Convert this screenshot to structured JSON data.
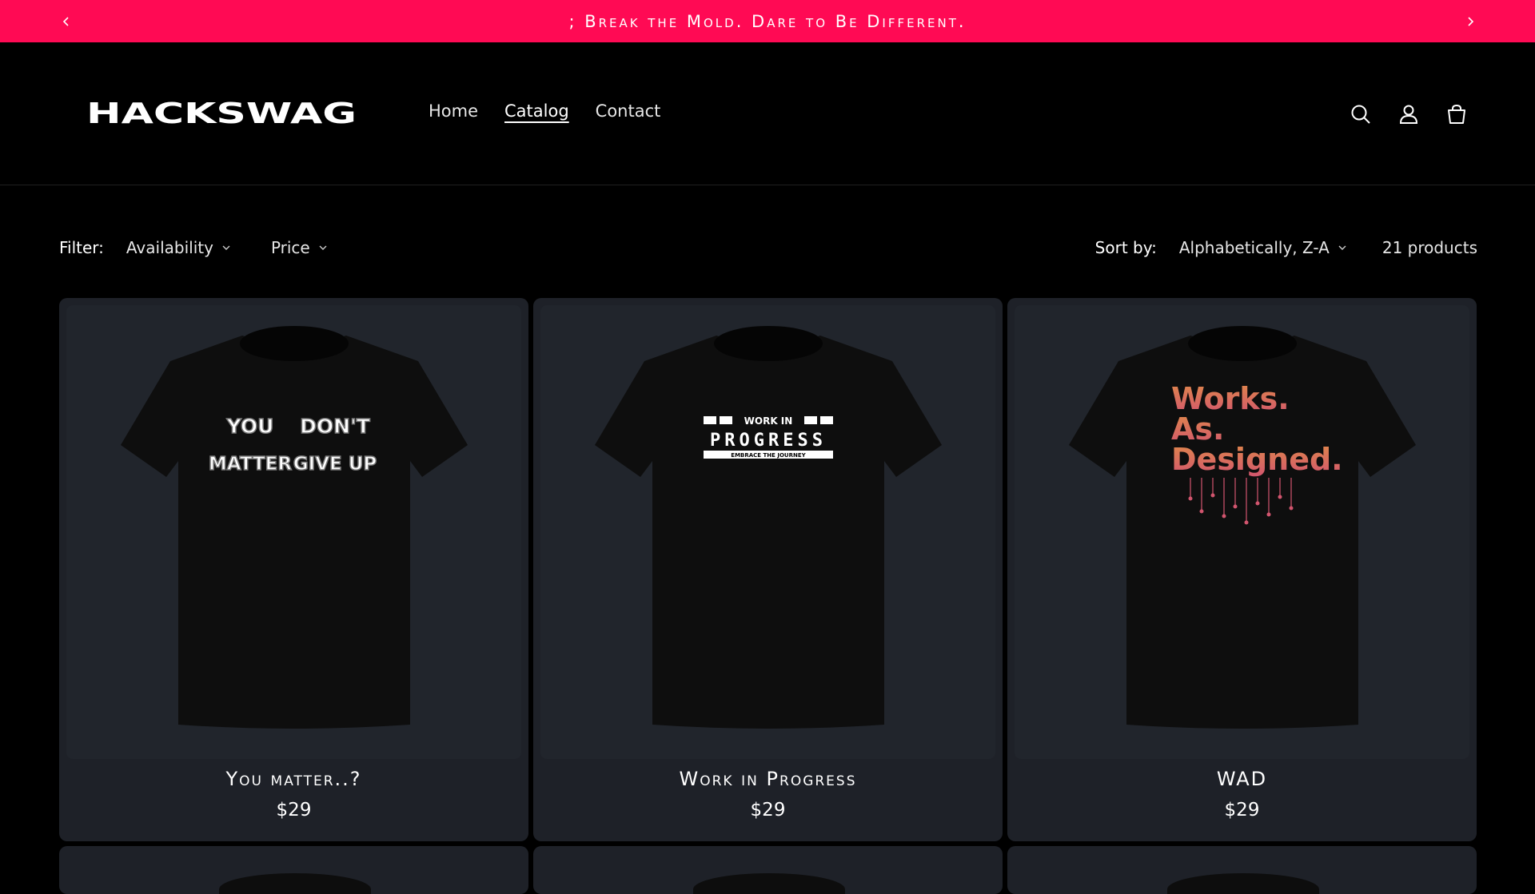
{
  "announcement": {
    "text": "; Break the Mold. Dare to Be Different.",
    "prev_icon": "chevron-left-icon",
    "next_icon": "chevron-right-icon"
  },
  "header": {
    "logo_text": "HACKSWAG",
    "nav": [
      {
        "label": "Home",
        "active": false
      },
      {
        "label": "Catalog",
        "active": true
      },
      {
        "label": "Contact",
        "active": false
      }
    ],
    "icons": [
      "search-icon",
      "account-icon",
      "cart-icon"
    ]
  },
  "facets": {
    "filter_label": "Filter:",
    "filters": [
      "Availability",
      "Price"
    ],
    "sort_label": "Sort by:",
    "sort_value": "Alphabetically, Z-A",
    "count": "21 products"
  },
  "products": [
    {
      "title": "You matter..?",
      "price": "$29",
      "design_text": [
        "YOU",
        "DON'T",
        "MATTER",
        "GIVE UP"
      ]
    },
    {
      "title": "Work in Progress",
      "price": "$29",
      "design_text": [
        "WORK IN",
        "PROGRESS",
        "EMBRACE THE JOURNEY"
      ]
    },
    {
      "title": "WAD",
      "price": "$29",
      "design_text": [
        "Works.",
        "As.",
        "Designed."
      ]
    }
  ],
  "colors": {
    "announcement_bg": "#ff0a54",
    "page_bg": "#000000",
    "card_bg": "#1e2128",
    "wad_orange": "#e0894a",
    "wad_pink": "#d2556e"
  }
}
